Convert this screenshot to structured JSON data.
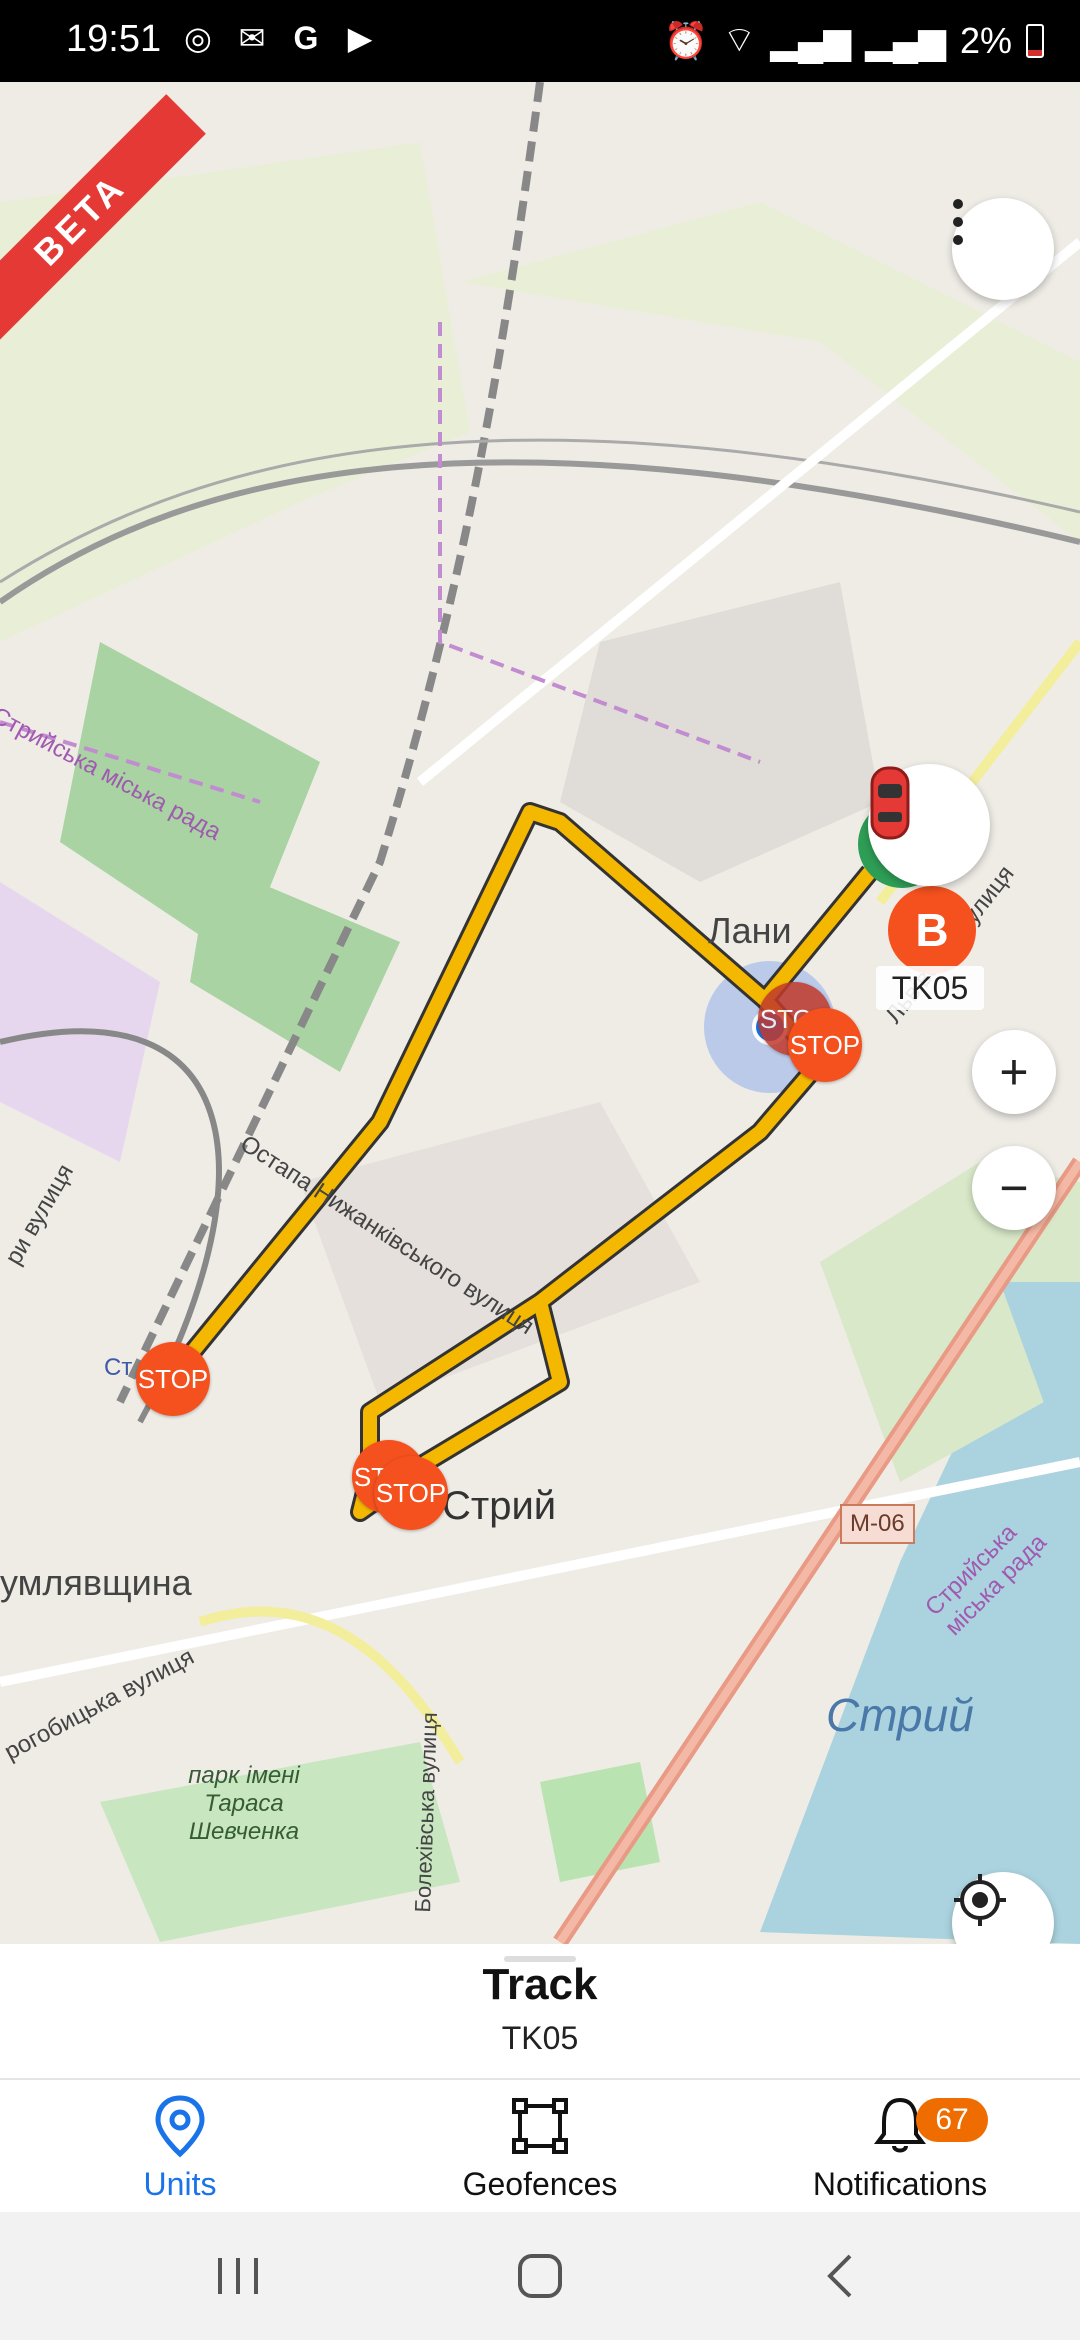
{
  "status_bar": {
    "time": "19:51",
    "battery": "2%"
  },
  "map": {
    "beta_label": "BETA",
    "labels": {
      "district_lany": "Лани",
      "city_stryi": "Стрий",
      "river_stryi": "Стрий",
      "district_dumlyavshchyna": "умлявщина",
      "street_ostapa": "Остапа Нижанківського вулиця",
      "street_lvivska": "Львівська вулиця",
      "street_drohobytska": "рогобицька вулиця",
      "street_boloh": "Болехівська вулиця",
      "street_left": "ри вулиця",
      "council_top": "Стрийська міська рада",
      "council_right": "Стрийська міська рада",
      "park": "парк імені Тараса Шевченка",
      "highway": "М-06",
      "station": "Ст"
    },
    "stop_label": "STOP",
    "unit": {
      "letter": "B",
      "name": "TK05"
    },
    "zoom_in": "+",
    "zoom_out": "−",
    "colors": {
      "track": "#f5b800",
      "stop": "#f4511e",
      "accent": "#1a73e8"
    }
  },
  "bottom_sheet": {
    "title": "Track",
    "subtitle": "TK05"
  },
  "tabs": [
    {
      "label": "Units",
      "icon": "location-pin-icon",
      "active": true
    },
    {
      "label": "Geofences",
      "icon": "geofence-square-icon",
      "active": false
    },
    {
      "label": "Notifications",
      "icon": "bell-icon",
      "active": false,
      "badge": "67"
    }
  ]
}
